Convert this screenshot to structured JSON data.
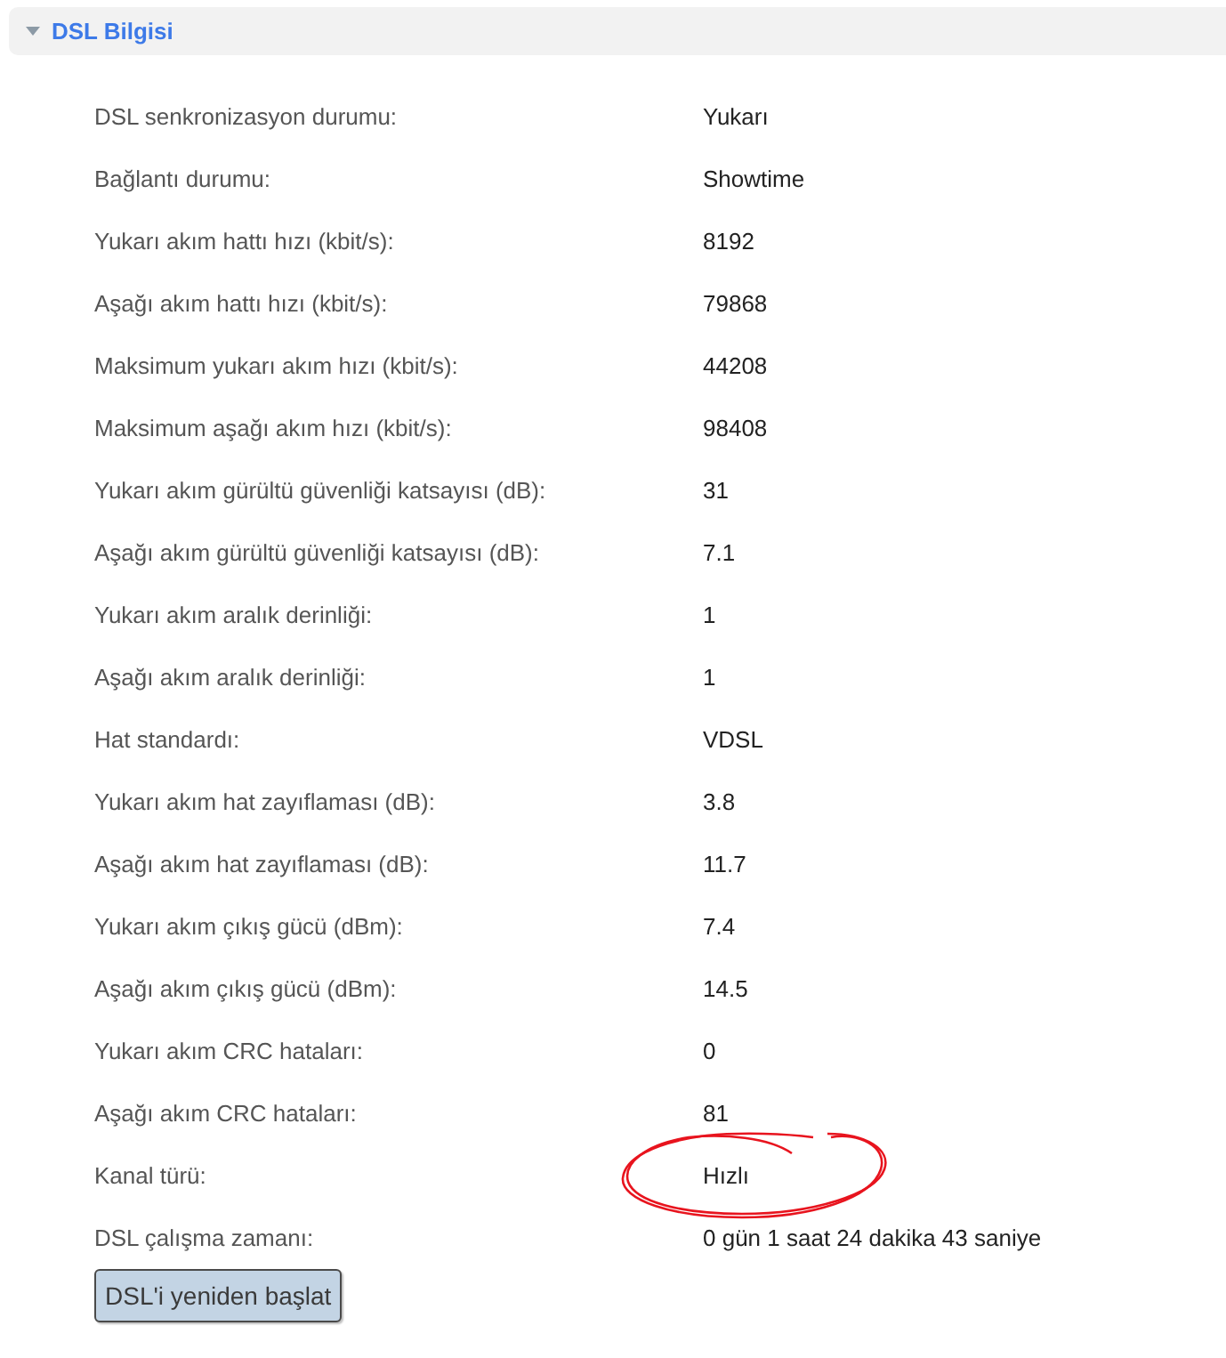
{
  "section": {
    "title": "DSL Bilgisi",
    "expanded": true
  },
  "rows": [
    {
      "label": "DSL senkronizasyon durumu:",
      "value": "Yukarı"
    },
    {
      "label": "Bağlantı durumu:",
      "value": "Showtime"
    },
    {
      "label": "Yukarı akım hattı hızı (kbit/s):",
      "value": "8192"
    },
    {
      "label": "Aşağı akım hattı hızı (kbit/s):",
      "value": "79868"
    },
    {
      "label": "Maksimum yukarı akım hızı (kbit/s):",
      "value": "44208"
    },
    {
      "label": "Maksimum aşağı akım hızı (kbit/s):",
      "value": "98408"
    },
    {
      "label": "Yukarı akım gürültü güvenliği katsayısı (dB):",
      "value": "31"
    },
    {
      "label": "Aşağı akım gürültü güvenliği katsayısı (dB):",
      "value": "7.1"
    },
    {
      "label": "Yukarı akım aralık derinliği:",
      "value": "1"
    },
    {
      "label": "Aşağı akım aralık derinliği:",
      "value": "1"
    },
    {
      "label": "Hat standardı:",
      "value": "VDSL"
    },
    {
      "label": "Yukarı akım hat zayıflaması (dB):",
      "value": "3.8"
    },
    {
      "label": "Aşağı akım hat zayıflaması (dB):",
      "value": "11.7"
    },
    {
      "label": "Yukarı akım çıkış gücü (dBm):",
      "value": "7.4"
    },
    {
      "label": "Aşağı akım çıkış gücü (dBm):",
      "value": "14.5"
    },
    {
      "label": "Yukarı akım CRC hataları:",
      "value": "0"
    },
    {
      "label": "Aşağı akım CRC hataları:",
      "value": "81"
    },
    {
      "label": "Kanal türü:",
      "value": "Hızlı"
    },
    {
      "label": "DSL çalışma zamanı:",
      "value": "0 gün 1 saat 24 dakika 43 saniye"
    }
  ],
  "buttons": [
    {
      "label": "DSL'i yeniden başlat"
    }
  ]
}
